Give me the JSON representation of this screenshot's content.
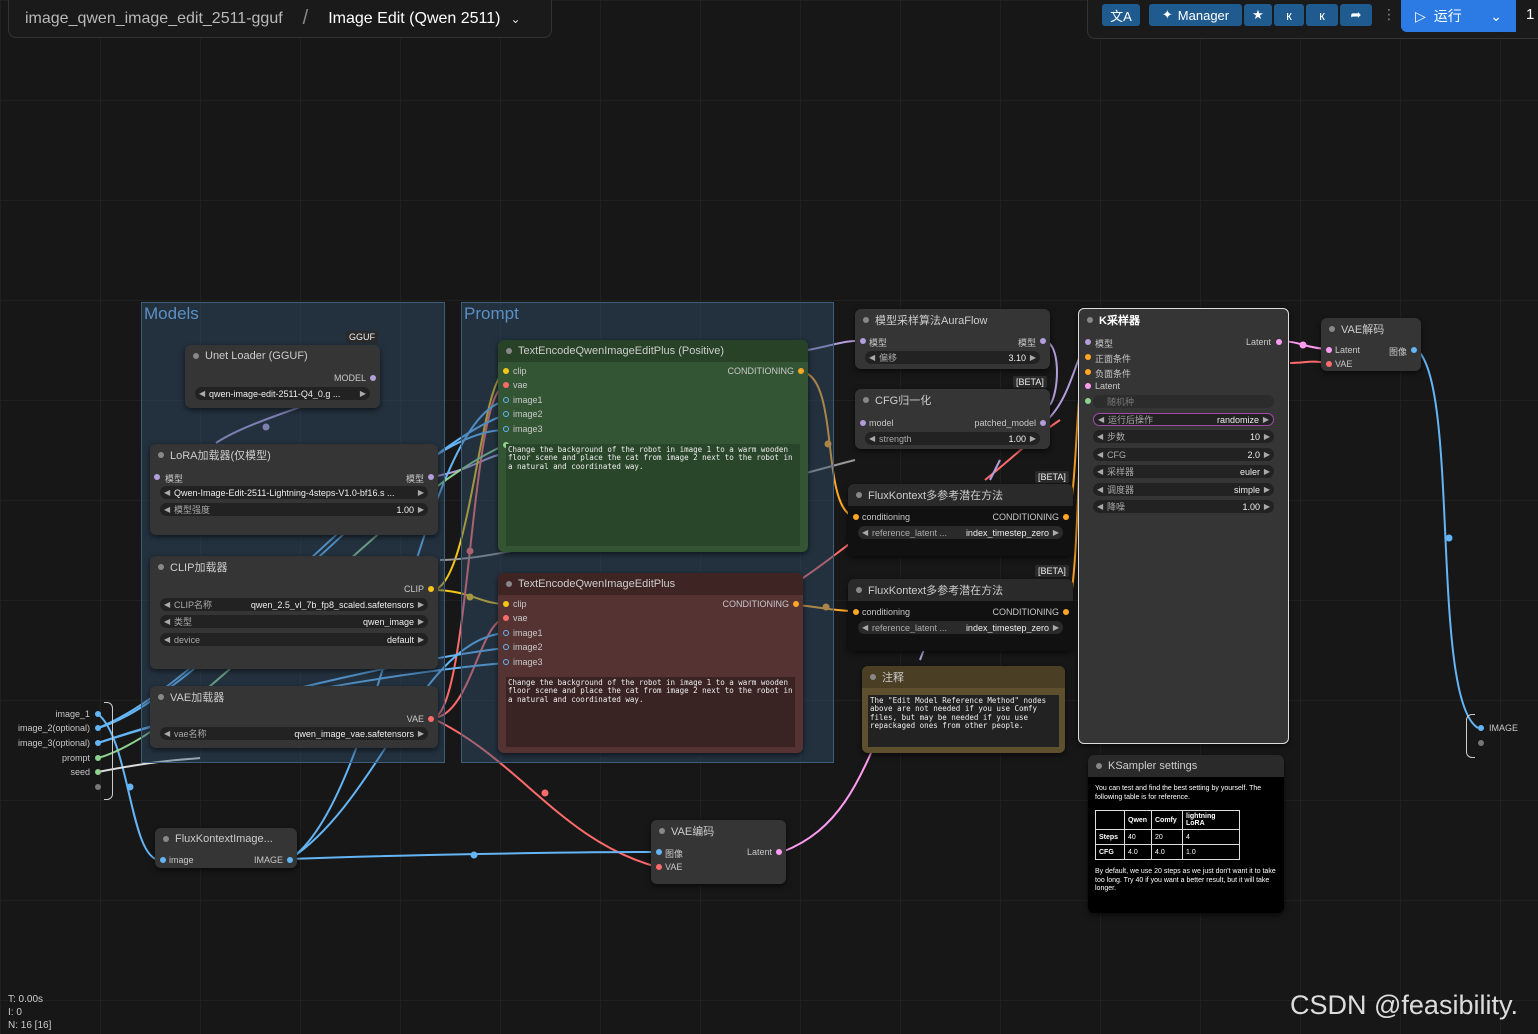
{
  "topbar": {
    "workflow_name": "image_qwen_image_edit_2511-gguf",
    "separator": "/",
    "tab_name": "Image Edit (Qwen 2511)",
    "translate_icon": "translate-icon",
    "manager_label": "Manager",
    "run_label": "运行",
    "queue_count": "1"
  },
  "groups": {
    "models": "Models",
    "prompt": "Prompt"
  },
  "unet": {
    "title": "Unet Loader (GGUF)",
    "badge": "GGUF",
    "output": "MODEL",
    "unet_name": "qwen-image-edit-2511-Q4_0.g ..."
  },
  "lora": {
    "title": "LoRA加载器(仅模型)",
    "input": "模型",
    "output": "模型",
    "lora_name": "Qwen-Image-Edit-2511-Lightning-4steps-V1.0-bf16.s ...",
    "strength_label": "模型强度",
    "strength_value": "1.00"
  },
  "clip_loader": {
    "title": "CLIP加载器",
    "output": "CLIP",
    "clip_name_label": "CLIP名称",
    "clip_name_value": "qwen_2.5_vl_7b_fp8_scaled.safetensors",
    "type_label": "类型",
    "type_value": "qwen_image",
    "device_label": "device",
    "device_value": "default"
  },
  "vae_loader": {
    "title": "VAE加载器",
    "output": "VAE",
    "vae_label": "vae名称",
    "vae_value": "qwen_image_vae.safetensors"
  },
  "inputs_list": [
    "image_1",
    "image_2(optional)",
    "image_3(optional)",
    "prompt",
    "seed"
  ],
  "positive": {
    "title": "TextEncodeQwenImageEditPlus (Positive)",
    "inputs": [
      "clip",
      "vae",
      "image1",
      "image2",
      "image3"
    ],
    "output": "CONDITIONING",
    "text": "Change the background of the robot in image 1 to a warm wooden floor scene and place the cat from image 2 next to the robot in a natural and coordinated way."
  },
  "negative": {
    "title": "TextEncodeQwenImageEditPlus",
    "inputs": [
      "clip",
      "vae",
      "image1",
      "image2",
      "image3"
    ],
    "output": "CONDITIONING",
    "text": "Change the background of the robot in image 1 to a warm wooden floor scene and place the cat from image 2 next to the robot in a natural and coordinated way."
  },
  "auraflow": {
    "title": "模型采样算法AuraFlow",
    "input": "模型",
    "output": "模型",
    "shift_label": "偏移",
    "shift_value": "3.10"
  },
  "cfgnorm": {
    "title": "CFG归一化",
    "badge": "[BETA]",
    "input": "model",
    "output": "patched_model",
    "strength_label": "strength",
    "strength_value": "1.00"
  },
  "flux1": {
    "title": "FluxKontext多参考潜在方法",
    "badge": "[BETA]",
    "input": "conditioning",
    "output": "CONDITIONING",
    "method_label": "reference_latent ...",
    "method_value": "index_timestep_zero"
  },
  "flux2": {
    "title": "FluxKontext多参考潜在方法",
    "badge": "[BETA]",
    "input": "conditioning",
    "output": "CONDITIONING",
    "method_label": "reference_latent ...",
    "method_value": "index_timestep_zero"
  },
  "note": {
    "title": "注释",
    "text": "The \"Edit Model Reference Method\" nodes above are not needed if you use Comfy files, but may be needed if you use repackaged ones from other people."
  },
  "ksampler": {
    "title": "K采样器",
    "inputs": [
      "模型",
      "正面条件",
      "负面条件",
      "Latent"
    ],
    "output": "Latent",
    "seed_label": "随机种",
    "widgets": [
      {
        "label": "运行后操作",
        "value": "randomize"
      },
      {
        "label": "步数",
        "value": "10"
      },
      {
        "label": "CFG",
        "value": "2.0"
      },
      {
        "label": "采样器",
        "value": "euler"
      },
      {
        "label": "调度器",
        "value": "simple"
      },
      {
        "label": "降噪",
        "value": "1.00"
      }
    ]
  },
  "vaedecode": {
    "title": "VAE解码",
    "inputs": [
      "Latent",
      "VAE"
    ],
    "output": "图像"
  },
  "output_image": "IMAGE",
  "fluxscale": {
    "title": "FluxKontextImage...",
    "input": "image",
    "output": "IMAGE"
  },
  "vaeencode": {
    "title": "VAE编码",
    "inputs": [
      "图像",
      "VAE"
    ],
    "output": "Latent"
  },
  "settings": {
    "title": "KSampler settings",
    "intro": "You can test and find the best setting by yourself. The following table is for reference.",
    "table_header": [
      "",
      "Qwen",
      "Comfy",
      "lightning LoRA"
    ],
    "table_rows": [
      [
        "Steps",
        "40",
        "20",
        "4"
      ],
      [
        "CFG",
        "4.0",
        "4.0",
        "1.0"
      ]
    ],
    "outro": "By default, we use 20 steps as we just don't want it to take too long. Try 40 if you want a better result, but it will take longer."
  },
  "stats": {
    "time": "T: 0.00s",
    "iter": "I: 0",
    "nodes": "N: 16 [16]"
  },
  "watermark": "CSDN @feasibility.",
  "colors": {
    "clip": "#f5c518",
    "vae": "#ff6b6b",
    "model": "#b39ddb",
    "image": "#64b5f6",
    "conditioning": "#ffa726",
    "latent": "#ff9cf2"
  }
}
